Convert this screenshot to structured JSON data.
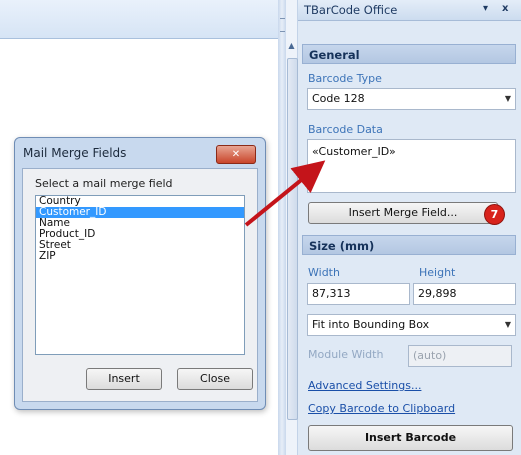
{
  "dialog": {
    "title": "Mail Merge Fields",
    "prompt": "Select a mail merge field",
    "fields": [
      "Country",
      "Customer_ID",
      "Name",
      "Product_ID",
      "Street",
      "ZIP"
    ],
    "selected_index": 1,
    "insert_label": "Insert",
    "close_label": "Close"
  },
  "pane": {
    "title": "TBarCode Office",
    "pin_glyph": "▾",
    "close_glyph": "x",
    "general_header": "General",
    "barcode_type_label": "Barcode Type",
    "barcode_type_value": "Code 128",
    "barcode_data_label": "Barcode Data",
    "barcode_data_value": "«Customer_ID»",
    "insert_merge_label": "Insert Merge Field...",
    "step_number": "7",
    "size_header": "Size (mm)",
    "width_label": "Width",
    "height_label": "Height",
    "width_value": "87,313",
    "height_value": "29,898",
    "fit_value": "Fit into Bounding Box",
    "module_width_label": "Module Width",
    "module_width_value": "(auto)",
    "advanced_link": "Advanced Settings...",
    "copy_link": "Copy Barcode to Clipboard",
    "insert_barcode_label": "Insert Barcode"
  },
  "colors": {
    "accent_red": "#d8231c",
    "selection_blue": "#3399ff",
    "label_blue": "#3d74b8"
  }
}
